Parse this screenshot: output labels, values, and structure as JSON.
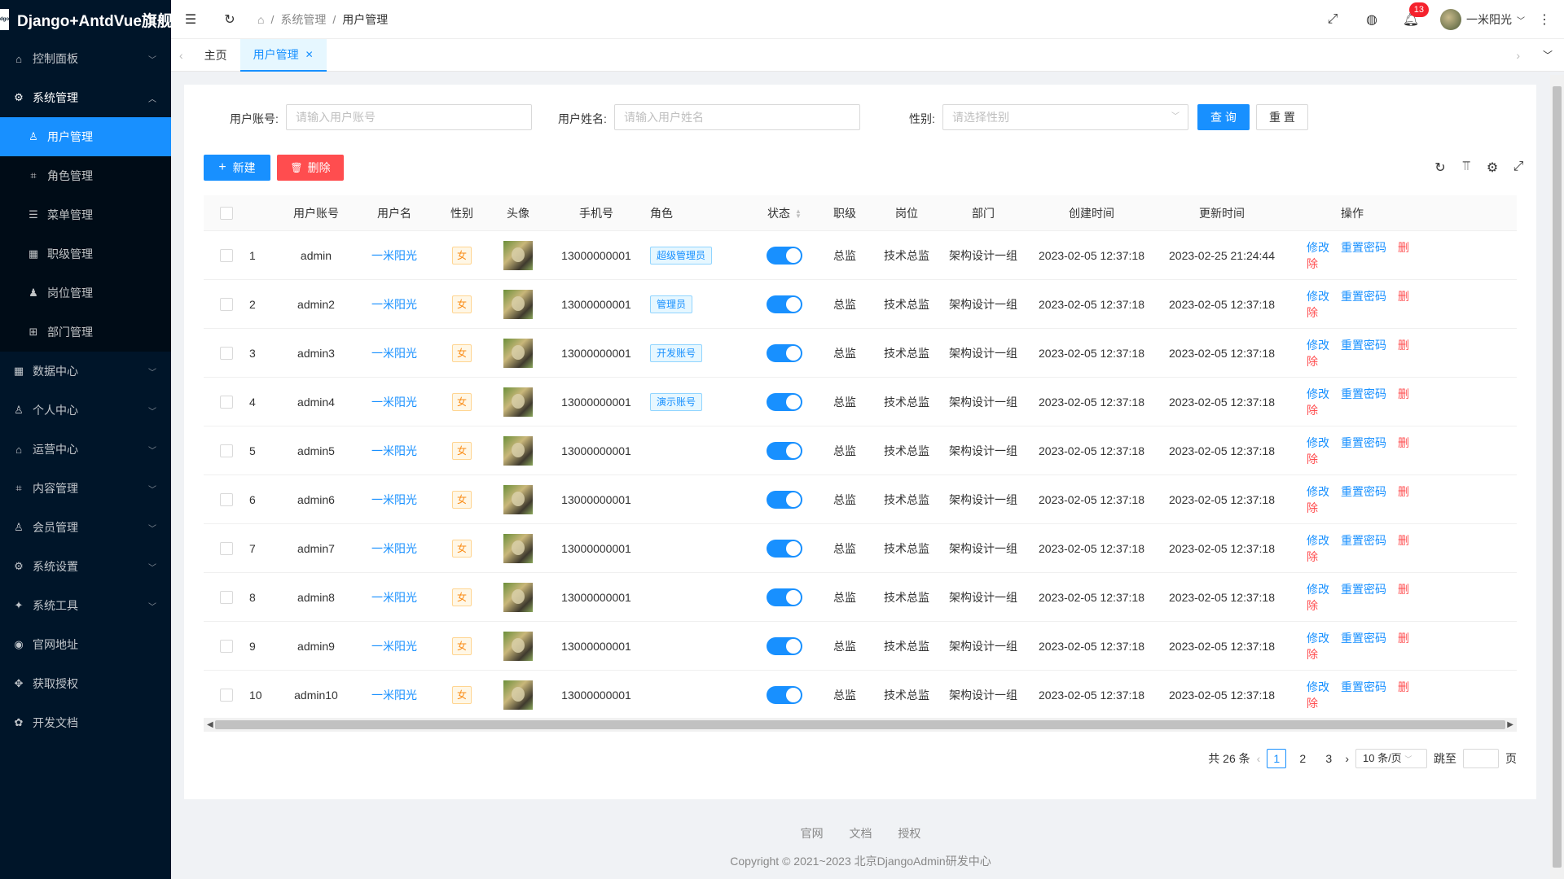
{
  "app": {
    "title": "Django+AntdVue旗舰版"
  },
  "menu": {
    "items": [
      {
        "label": "控制面板",
        "icon": "home-icon"
      },
      {
        "label": "系统管理",
        "icon": "gear-icon",
        "open": true
      },
      {
        "label": "数据中心",
        "icon": "grid-icon"
      },
      {
        "label": "个人中心",
        "icon": "user-icon"
      },
      {
        "label": "运营中心",
        "icon": "ops-icon"
      },
      {
        "label": "内容管理",
        "icon": "content-icon"
      },
      {
        "label": "会员管理",
        "icon": "member-icon"
      },
      {
        "label": "系统设置",
        "icon": "settings-icon"
      },
      {
        "label": "系统工具",
        "icon": "tools-icon"
      },
      {
        "label": "官网地址",
        "icon": "globe-icon"
      },
      {
        "label": "获取授权",
        "icon": "key-icon"
      },
      {
        "label": "开发文档",
        "icon": "doc-icon"
      }
    ],
    "sub": [
      {
        "label": "用户管理",
        "active": true
      },
      {
        "label": "角色管理"
      },
      {
        "label": "菜单管理"
      },
      {
        "label": "职级管理"
      },
      {
        "label": "岗位管理"
      },
      {
        "label": "部门管理"
      }
    ]
  },
  "header": {
    "breadcrumb": [
      "系统管理",
      "用户管理"
    ],
    "notice_count": "13",
    "user": "一米阳光"
  },
  "tabs": {
    "home": "主页",
    "current": "用户管理"
  },
  "search": {
    "account_label": "用户账号:",
    "account_placeholder": "请输入用户账号",
    "name_label": "用户姓名:",
    "name_placeholder": "请输入用户姓名",
    "gender_label": "性别:",
    "gender_placeholder": "请选择性别",
    "query": "查 询",
    "reset": "重 置"
  },
  "actions": {
    "add": "新建",
    "delete": "删除"
  },
  "table": {
    "columns": [
      "用户账号",
      "用户名",
      "性别",
      "头像",
      "手机号",
      "角色",
      "状态",
      "职级",
      "岗位",
      "部门",
      "创建时间",
      "更新时间",
      "操作"
    ],
    "op_edit": "修改",
    "op_reset": "重置密码",
    "op_delete": "删除",
    "rows": [
      {
        "idx": "1",
        "account": "admin",
        "name": "一米阳光",
        "gender": "女",
        "mobile": "13000000001",
        "role": "超级管理员",
        "level": "总监",
        "post": "技术总监",
        "dept": "架构设计一组",
        "created": "2023-02-05 12:37:18",
        "updated": "2023-02-25 21:24:44"
      },
      {
        "idx": "2",
        "account": "admin2",
        "name": "一米阳光",
        "gender": "女",
        "mobile": "13000000001",
        "role": "管理员",
        "level": "总监",
        "post": "技术总监",
        "dept": "架构设计一组",
        "created": "2023-02-05 12:37:18",
        "updated": "2023-02-05 12:37:18"
      },
      {
        "idx": "3",
        "account": "admin3",
        "name": "一米阳光",
        "gender": "女",
        "mobile": "13000000001",
        "role": "开发账号",
        "level": "总监",
        "post": "技术总监",
        "dept": "架构设计一组",
        "created": "2023-02-05 12:37:18",
        "updated": "2023-02-05 12:37:18"
      },
      {
        "idx": "4",
        "account": "admin4",
        "name": "一米阳光",
        "gender": "女",
        "mobile": "13000000001",
        "role": "演示账号",
        "level": "总监",
        "post": "技术总监",
        "dept": "架构设计一组",
        "created": "2023-02-05 12:37:18",
        "updated": "2023-02-05 12:37:18"
      },
      {
        "idx": "5",
        "account": "admin5",
        "name": "一米阳光",
        "gender": "女",
        "mobile": "13000000001",
        "role": "",
        "level": "总监",
        "post": "技术总监",
        "dept": "架构设计一组",
        "created": "2023-02-05 12:37:18",
        "updated": "2023-02-05 12:37:18"
      },
      {
        "idx": "6",
        "account": "admin6",
        "name": "一米阳光",
        "gender": "女",
        "mobile": "13000000001",
        "role": "",
        "level": "总监",
        "post": "技术总监",
        "dept": "架构设计一组",
        "created": "2023-02-05 12:37:18",
        "updated": "2023-02-05 12:37:18"
      },
      {
        "idx": "7",
        "account": "admin7",
        "name": "一米阳光",
        "gender": "女",
        "mobile": "13000000001",
        "role": "",
        "level": "总监",
        "post": "技术总监",
        "dept": "架构设计一组",
        "created": "2023-02-05 12:37:18",
        "updated": "2023-02-05 12:37:18"
      },
      {
        "idx": "8",
        "account": "admin8",
        "name": "一米阳光",
        "gender": "女",
        "mobile": "13000000001",
        "role": "",
        "level": "总监",
        "post": "技术总监",
        "dept": "架构设计一组",
        "created": "2023-02-05 12:37:18",
        "updated": "2023-02-05 12:37:18"
      },
      {
        "idx": "9",
        "account": "admin9",
        "name": "一米阳光",
        "gender": "女",
        "mobile": "13000000001",
        "role": "",
        "level": "总监",
        "post": "技术总监",
        "dept": "架构设计一组",
        "created": "2023-02-05 12:37:18",
        "updated": "2023-02-05 12:37:18"
      },
      {
        "idx": "10",
        "account": "admin10",
        "name": "一米阳光",
        "gender": "女",
        "mobile": "13000000001",
        "role": "",
        "level": "总监",
        "post": "技术总监",
        "dept": "架构设计一组",
        "created": "2023-02-05 12:37:18",
        "updated": "2023-02-05 12:37:18"
      }
    ]
  },
  "pager": {
    "total": "共 26 条",
    "pages": [
      "1",
      "2",
      "3"
    ],
    "current": "1",
    "size": "10 条/页",
    "jump": "跳至",
    "page_unit": "页"
  },
  "footer": {
    "links": [
      "官网",
      "文档",
      "授权"
    ],
    "copyright": "Copyright © 2021~2023 北京DjangoAdmin研发中心"
  },
  "colors": {
    "primary": "#1890ff",
    "danger": "#ff4d4f",
    "sidebar": "#001529"
  }
}
